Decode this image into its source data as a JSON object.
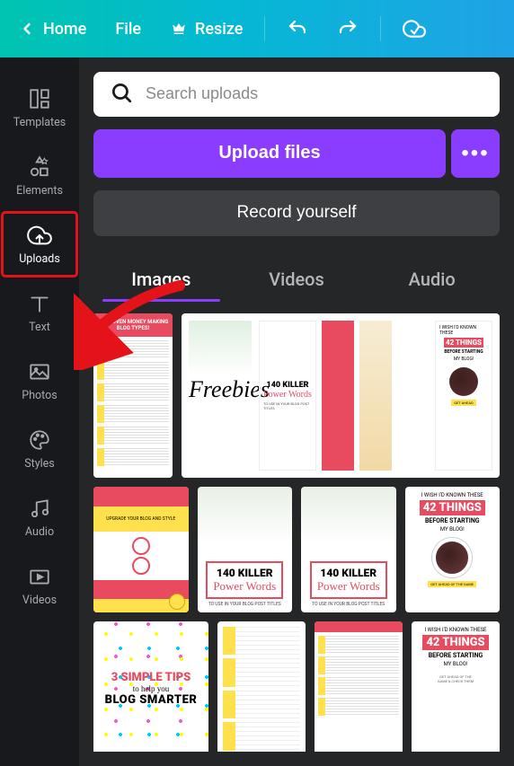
{
  "topbar": {
    "home": "Home",
    "file": "File",
    "resize": "Resize"
  },
  "sidebar": {
    "items": [
      {
        "label": "Templates"
      },
      {
        "label": "Elements"
      },
      {
        "label": "Uploads"
      },
      {
        "label": "Text"
      },
      {
        "label": "Photos"
      },
      {
        "label": "Styles"
      },
      {
        "label": "Audio"
      },
      {
        "label": "Videos"
      }
    ]
  },
  "search": {
    "placeholder": "Search uploads"
  },
  "buttons": {
    "upload": "Upload files",
    "record": "Record yourself"
  },
  "tabs": {
    "images": "Images",
    "videos": "Videos",
    "audio": "Audio"
  },
  "thumbnails": {
    "row1_a": {
      "title": "12 PROVEN MONEY MAKING BLOG TYPES!"
    },
    "row1_b": {
      "freebies": "Freebies",
      "killer": "140 KILLER",
      "power": "Power Words",
      "sub": "TO USE IN YOUR BLOG POST TITLES",
      "things_pre": "I WISH I'D KNOWN THESE",
      "things_num": "42 THINGS",
      "things_sub": "BEFORE STARTING",
      "things_what": "MY BLOG!"
    },
    "row2": [
      {
        "title": "UPGRADE YOUR BLOG AND STYLE"
      },
      {
        "killer": "140 KILLER",
        "power": "Power Words",
        "sub": "TO USE IN YOUR BLOG POST TITLES"
      },
      {
        "killer": "140 KILLER",
        "power": "Power Words",
        "sub": "TO USE IN YOUR BLOG POST TITLES"
      },
      {
        "pre": "I WISH I'D KNOWN THESE",
        "num": "42 THINGS",
        "sub": "BEFORE STARTING",
        "what": "MY BLOG!"
      }
    ],
    "row3": [
      {
        "line1": "3 SIMPLE TIPS",
        "line2": "to help you",
        "line3": "BLOG SMARTER"
      },
      {
        "title": ""
      },
      {
        "title": ""
      },
      {
        "pre": "I WISH I'D KNOWN THESE",
        "num": "42 THINGS",
        "sub": "BEFORE STARTING",
        "what": "MY BLOG!"
      }
    ]
  }
}
